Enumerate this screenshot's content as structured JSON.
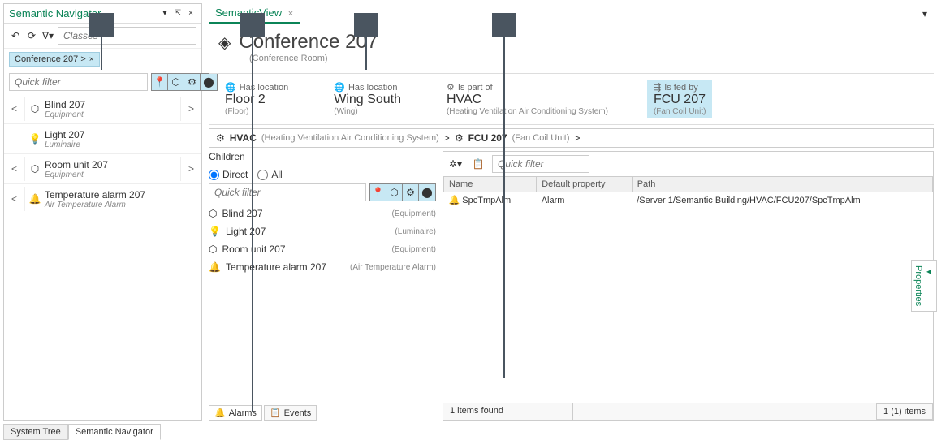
{
  "leftPanel": {
    "title": "Semantic Navigator",
    "classesPlaceholder": "Classes",
    "crumb": "Conference 207 >",
    "quickFilterPlaceholder": "Quick filter",
    "items": [
      {
        "name": "Blind 207",
        "sub": "Equipment",
        "icon": "cube",
        "hasBack": true,
        "hasFwd": true
      },
      {
        "name": "Light 207",
        "sub": "Luminaire",
        "icon": "light",
        "hasBack": false,
        "hasFwd": false
      },
      {
        "name": "Room unit 207",
        "sub": "Equipment",
        "icon": "cube",
        "hasBack": true,
        "hasFwd": true
      },
      {
        "name": "Temperature alarm 207",
        "sub": "Air Temperature Alarm",
        "icon": "bell",
        "hasBack": true,
        "hasFwd": false
      }
    ],
    "bottomTabs": [
      "System Tree",
      "Semantic Navigator"
    ]
  },
  "rightPanel": {
    "tabLabel": "SemanticView",
    "title": "Conference 207",
    "subtitle": "(Conference Room)",
    "relations": [
      {
        "label": "Has location",
        "name": "Floor 2",
        "sub": "(Floor)",
        "icon": "globe",
        "highlight": false
      },
      {
        "label": "Has location",
        "name": "Wing South",
        "sub": "(Wing)",
        "icon": "globe",
        "highlight": false
      },
      {
        "label": "Is part of",
        "name": "HVAC",
        "sub": "(Heating Ventilation Air Conditioning System)",
        "icon": "gear",
        "highlight": false
      },
      {
        "label": "Is fed by",
        "name": "FCU 207",
        "sub": "(Fan Coil Unit)",
        "icon": "feed",
        "highlight": true
      }
    ],
    "hvacCrumb": {
      "p1": "HVAC",
      "p1sub": "(Heating Ventilation Air Conditioning System)",
      "p2": "FCU 207",
      "p2sub": "(Fan Coil Unit)"
    },
    "children": {
      "title": "Children",
      "radioDirect": "Direct",
      "radioAll": "All",
      "quickFilterPlaceholder": "Quick filter",
      "items": [
        {
          "name": "Blind 207",
          "type": "(Equipment)",
          "icon": "cube"
        },
        {
          "name": "Light 207",
          "type": "(Luminaire)",
          "icon": "light"
        },
        {
          "name": "Room unit 207",
          "type": "(Equipment)",
          "icon": "cube"
        },
        {
          "name": "Temperature alarm 207",
          "type": "(Air Temperature Alarm)",
          "icon": "bell"
        }
      ]
    },
    "details": {
      "quickFilterPlaceholder": "Quick filter",
      "columns": [
        "Name",
        "Default property",
        "Path"
      ],
      "rows": [
        {
          "name": "SpcTmpAlm",
          "defaultProperty": "Alarm",
          "path": "/Server 1/Semantic Building/HVAC/FCU207/SpcTmpAlm"
        }
      ],
      "footerLeft": "1 items found",
      "footerRight": "1 (1) items"
    },
    "aeTabs": [
      "Alarms",
      "Events"
    ],
    "propsLabel": "Properties"
  }
}
